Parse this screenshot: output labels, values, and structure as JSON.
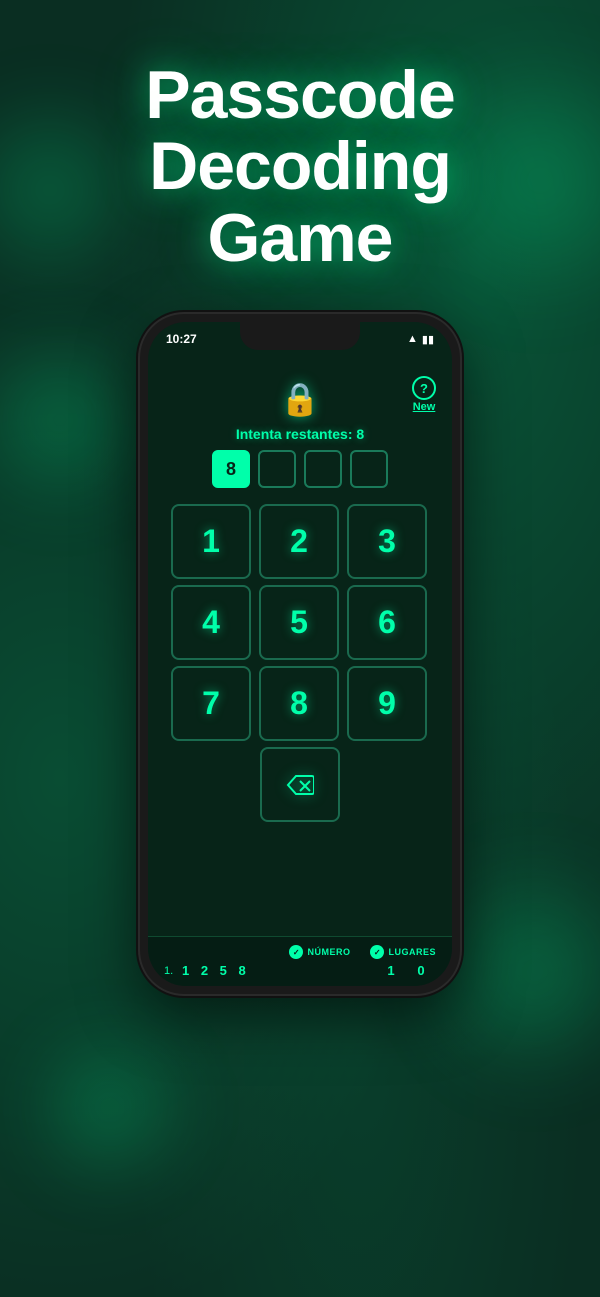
{
  "background": {
    "color": "#0a2e22"
  },
  "title": {
    "line1": "Passcode",
    "line2": "Decoding",
    "line3": "Game"
  },
  "status_bar": {
    "time": "10:27",
    "wifi": "WiFi",
    "battery": "Battery"
  },
  "app": {
    "lock_icon": "🔒",
    "help_circle": "?",
    "new_label": "New",
    "attempts_text": "Intenta restantes: 8",
    "slots": [
      {
        "value": "8",
        "filled": true
      },
      {
        "value": "",
        "filled": false
      },
      {
        "value": "",
        "filled": false
      },
      {
        "value": "",
        "filled": false
      }
    ],
    "numpad": [
      {
        "label": "1"
      },
      {
        "label": "2"
      },
      {
        "label": "3"
      },
      {
        "label": "4"
      },
      {
        "label": "5"
      },
      {
        "label": "6"
      },
      {
        "label": "7"
      },
      {
        "label": "8"
      },
      {
        "label": "9"
      }
    ],
    "delete_label": "⌫",
    "bottom": {
      "col1_label": "NÚMERO",
      "col2_label": "LUGARES",
      "history": [
        {
          "row_num": "1.",
          "guess": "1  2  5  8",
          "score1": "1",
          "score2": "0"
        }
      ]
    }
  }
}
